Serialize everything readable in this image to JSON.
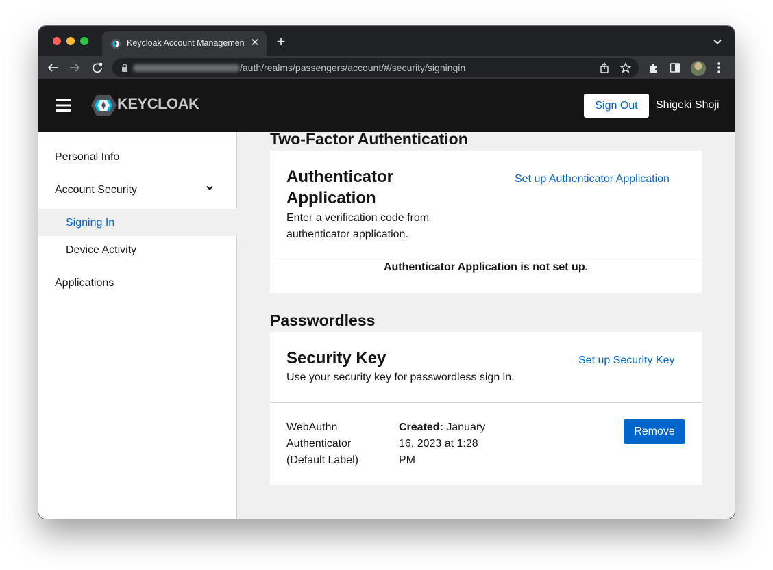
{
  "browser": {
    "tab_title": "Keycloak Account Management",
    "tab_close": "✕",
    "new_tab": "+",
    "url_path": "/auth/realms/passengers/account/#/security/signingin"
  },
  "header": {
    "brand": "KEYCLOAK",
    "sign_out": "Sign Out",
    "user_name": "Shigeki Shoji"
  },
  "sidebar": {
    "items": [
      {
        "label": "Personal Info"
      },
      {
        "label": "Account Security"
      },
      {
        "label": "Signing In",
        "active": true
      },
      {
        "label": "Device Activity"
      },
      {
        "label": "Applications"
      }
    ]
  },
  "two_factor": {
    "section_title": "Two-Factor Authentication",
    "card_title": "Authenticator Application",
    "description": "Enter a verification code from authenticator application.",
    "setup_link": "Set up Authenticator Application",
    "status": "Authenticator Application is not set up."
  },
  "passwordless": {
    "section_title": "Passwordless",
    "card_title": "Security Key",
    "description": "Use your security key for passwordless sign in.",
    "setup_link": "Set up Security Key",
    "credential": {
      "name": "WebAuthn Authenticator (Default Label)",
      "created_label": "Created:",
      "created_value": "January 16, 2023 at 1:28 PM",
      "remove": "Remove"
    }
  },
  "colors": {
    "link_blue": "#0066cc",
    "header_bg": "#151515",
    "page_bg": "#f0f0f0"
  }
}
